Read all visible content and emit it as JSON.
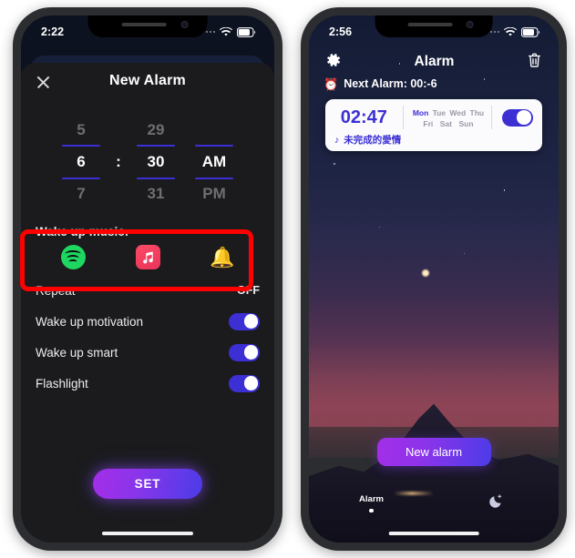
{
  "theme": {
    "accent_purple": "#3c2fd4",
    "annotation_red": "#ff0000",
    "spotify_green": "#1ed760",
    "apple_music_pink": "#f43f5e",
    "bell_yellow": "#f7b500",
    "gradient_button": "#a42ee8"
  },
  "left_phone": {
    "status_bar": {
      "time": "2:22"
    },
    "sheet": {
      "title": "New Alarm",
      "close_label": "×"
    },
    "time_picker": {
      "hour_prev": "5",
      "minute_prev": "29",
      "period_prev": "",
      "hour": "6",
      "separator": ":",
      "minute": "30",
      "period": "AM",
      "hour_next": "7",
      "minute_next": "31",
      "period_next": "PM"
    },
    "wake_up_music": {
      "label": "Wake up music:",
      "options": [
        {
          "name": "spotify",
          "icon": "spotify-icon"
        },
        {
          "name": "apple-music",
          "icon": "apple-music-icon"
        },
        {
          "name": "default-bell",
          "icon": "bell-icon"
        }
      ]
    },
    "settings_rows": [
      {
        "label": "Repeat",
        "value": "OFF",
        "control": "value"
      },
      {
        "label": "Wake up motivation",
        "value": "",
        "control": "toggle",
        "on": true
      },
      {
        "label": "Wake up smart",
        "value": "",
        "control": "toggle",
        "on": true
      },
      {
        "label": "Flashlight",
        "value": "",
        "control": "toggle",
        "on": true
      }
    ],
    "set_button": {
      "label": "SET"
    }
  },
  "right_phone": {
    "status_bar": {
      "time": "2:56"
    },
    "header": {
      "title": "Alarm",
      "settings_icon": "gear-icon",
      "delete_icon": "trash-icon"
    },
    "next_alarm": {
      "icon": "⏰",
      "text": "Next Alarm: 00:-6"
    },
    "alarm_card": {
      "time": "02:47",
      "days_row_1": [
        {
          "label": "Mon",
          "active": true
        },
        {
          "label": "Tue",
          "active": false
        },
        {
          "label": "Wed",
          "active": false
        },
        {
          "label": "Thu",
          "active": false
        }
      ],
      "days_row_2": [
        {
          "label": "Fri",
          "active": false
        },
        {
          "label": "Sat",
          "active": false
        },
        {
          "label": "Sun",
          "active": false
        }
      ],
      "enabled": true,
      "song_note": "♪",
      "song_title": "未完成的愛情"
    },
    "new_alarm_button": {
      "label": "New alarm"
    },
    "tab_bar": {
      "tabs": [
        {
          "label": "Alarm",
          "active": true,
          "icon": "alarm-tab"
        },
        {
          "label": "",
          "active": false,
          "icon": "moon-icon"
        }
      ]
    }
  }
}
